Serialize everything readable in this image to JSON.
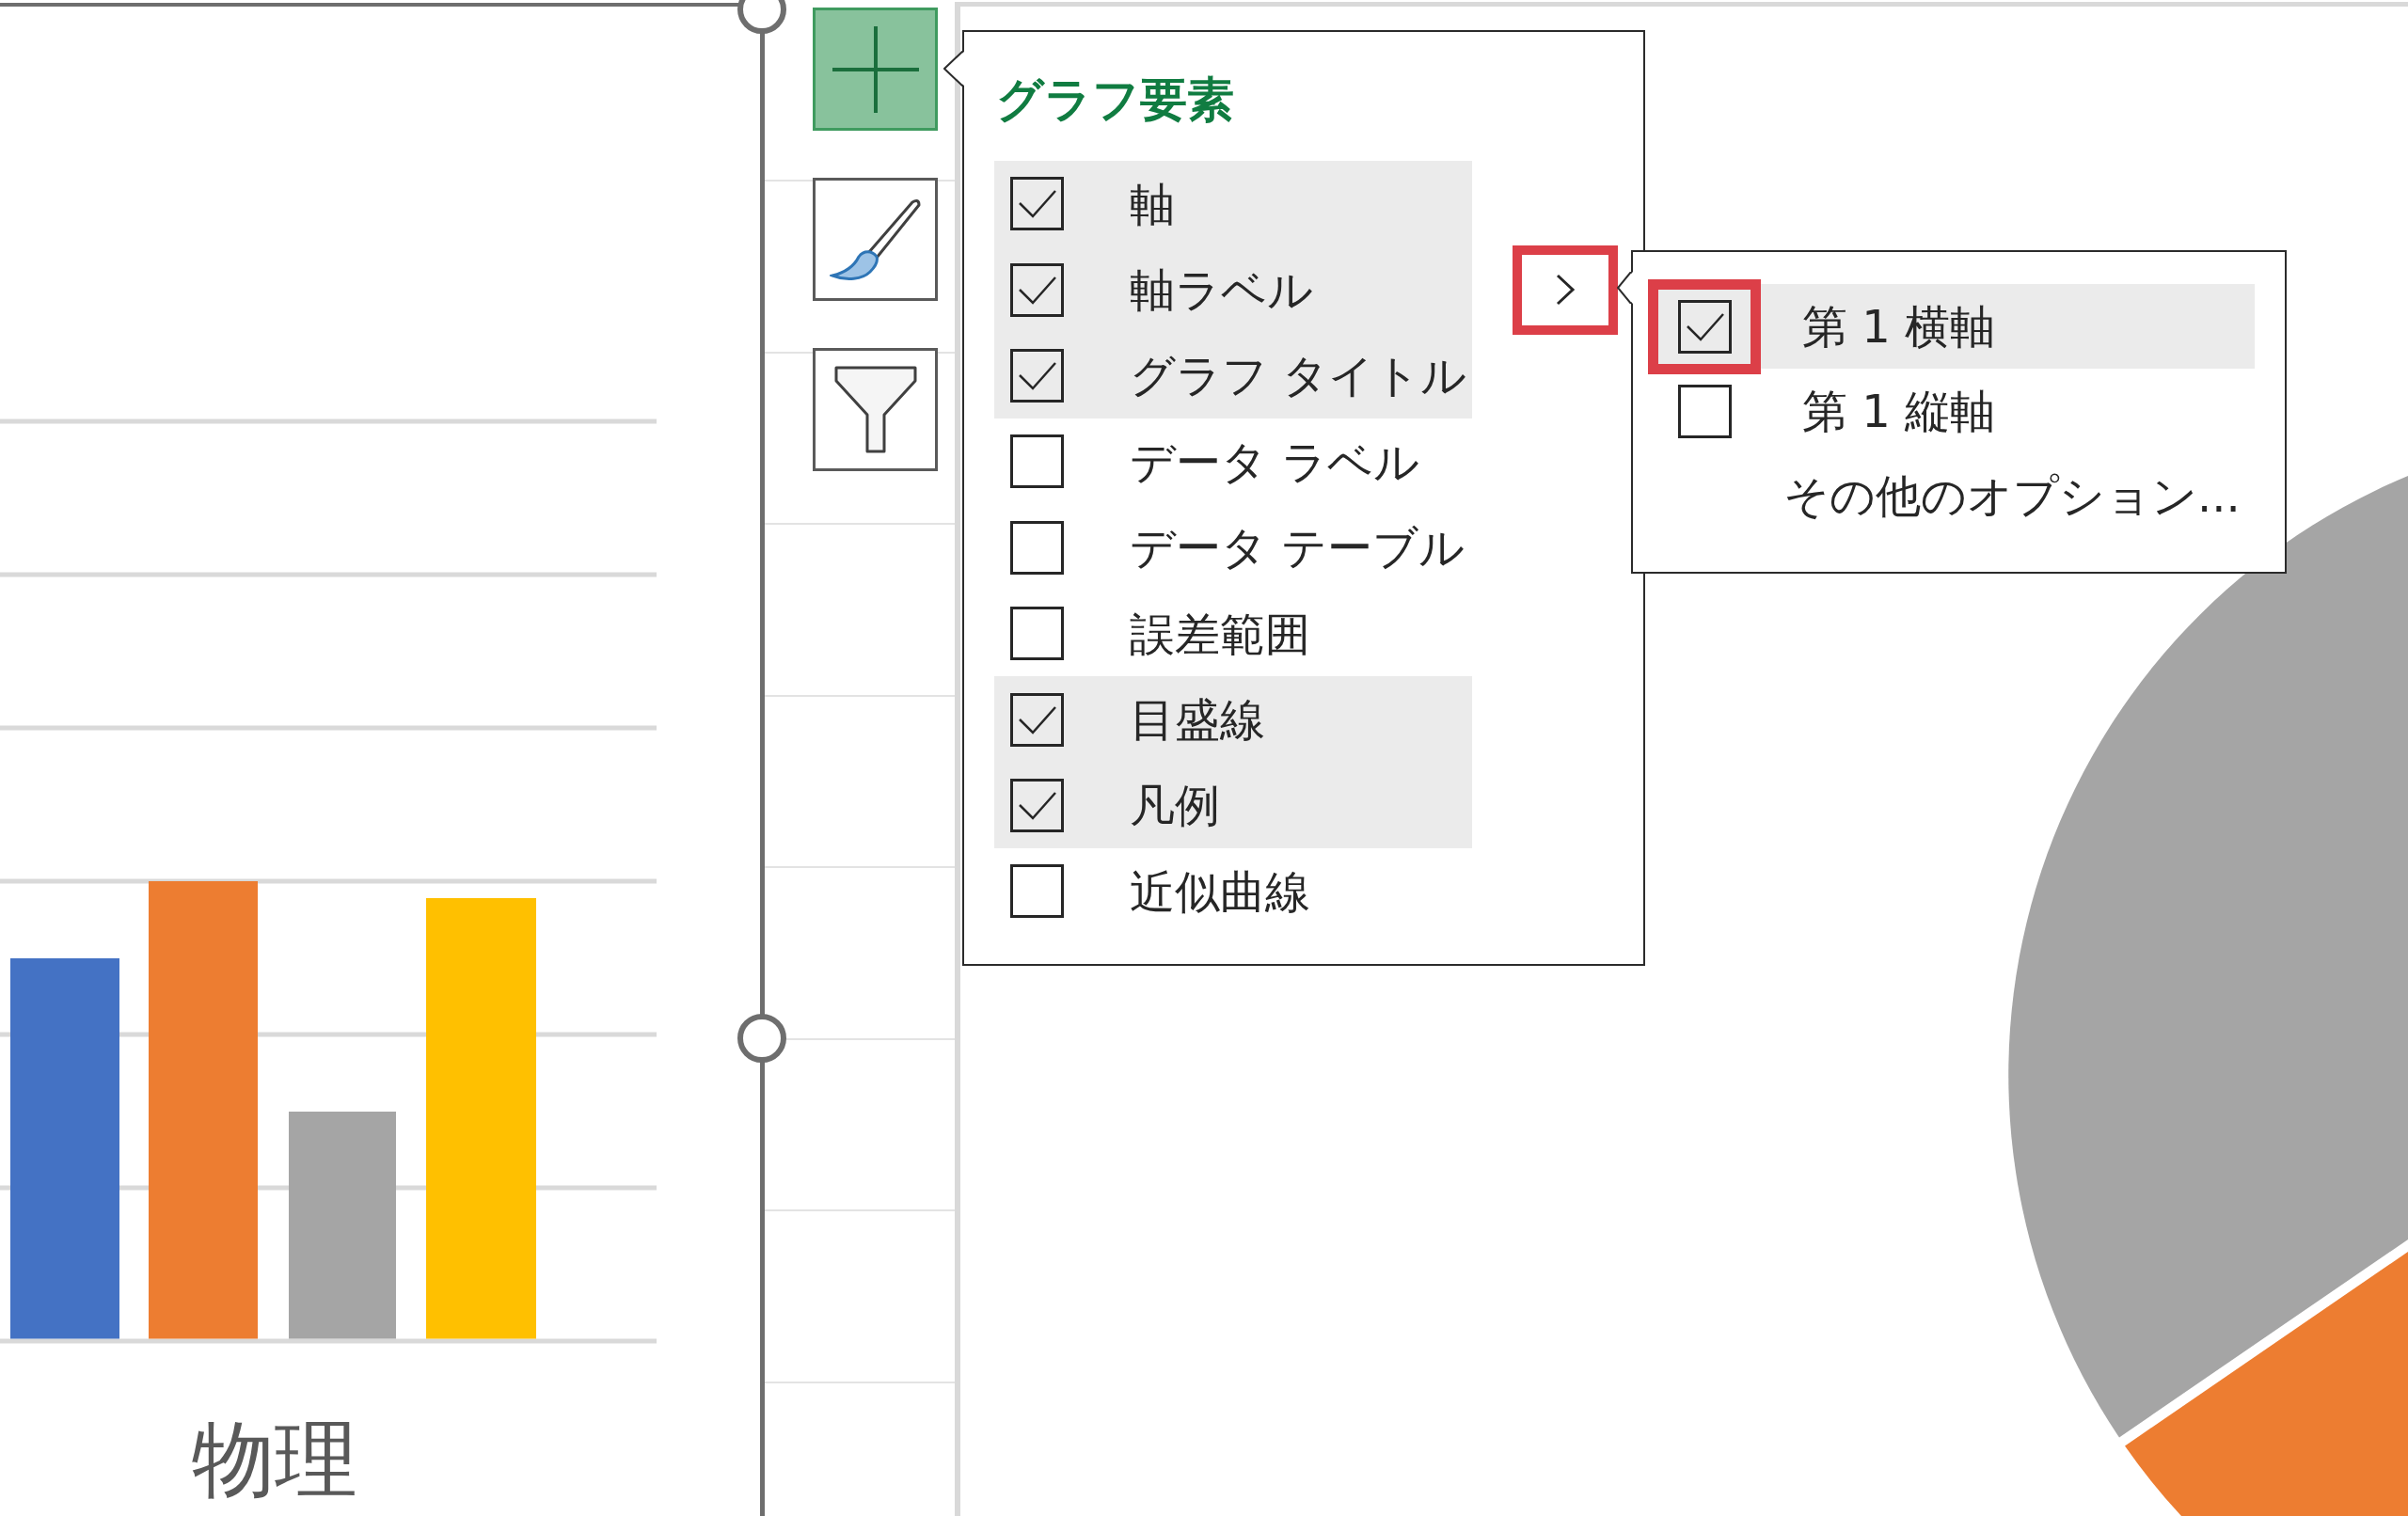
{
  "bar_chart": {
    "category_label": "物理"
  },
  "chart_buttons": [
    {
      "kind": "add",
      "selected": true
    },
    {
      "kind": "style",
      "selected": false
    },
    {
      "kind": "filter",
      "selected": false
    }
  ],
  "elements_panel": {
    "title": "グラフ要素",
    "items": [
      {
        "label": "軸",
        "checked": true,
        "expanded": false,
        "marked": false
      },
      {
        "label": "軸ラベル",
        "checked": true,
        "expanded": true,
        "marked": true,
        "submenu": [
          {
            "kind": "checkbox",
            "label": "第 1 横軸",
            "checked": true,
            "marked": true
          },
          {
            "kind": "checkbox",
            "label": "第 1 縦軸",
            "checked": false,
            "marked": false
          },
          {
            "kind": "command",
            "label": "その他のオプション..."
          }
        ]
      },
      {
        "label": "グラフ タイトル",
        "checked": true,
        "expanded": false,
        "marked": false
      },
      {
        "label": "データ ラベル",
        "checked": false,
        "expanded": false,
        "marked": false
      },
      {
        "label": "データ テーブル",
        "checked": false,
        "expanded": false,
        "marked": false
      },
      {
        "label": "誤差範囲",
        "checked": false,
        "expanded": false,
        "marked": false
      },
      {
        "label": "目盛線",
        "checked": true,
        "expanded": false,
        "marked": false
      },
      {
        "label": "凡例",
        "checked": true,
        "expanded": false,
        "marked": false
      },
      {
        "label": "近似曲線",
        "checked": false,
        "expanded": false,
        "marked": false
      }
    ]
  }
}
